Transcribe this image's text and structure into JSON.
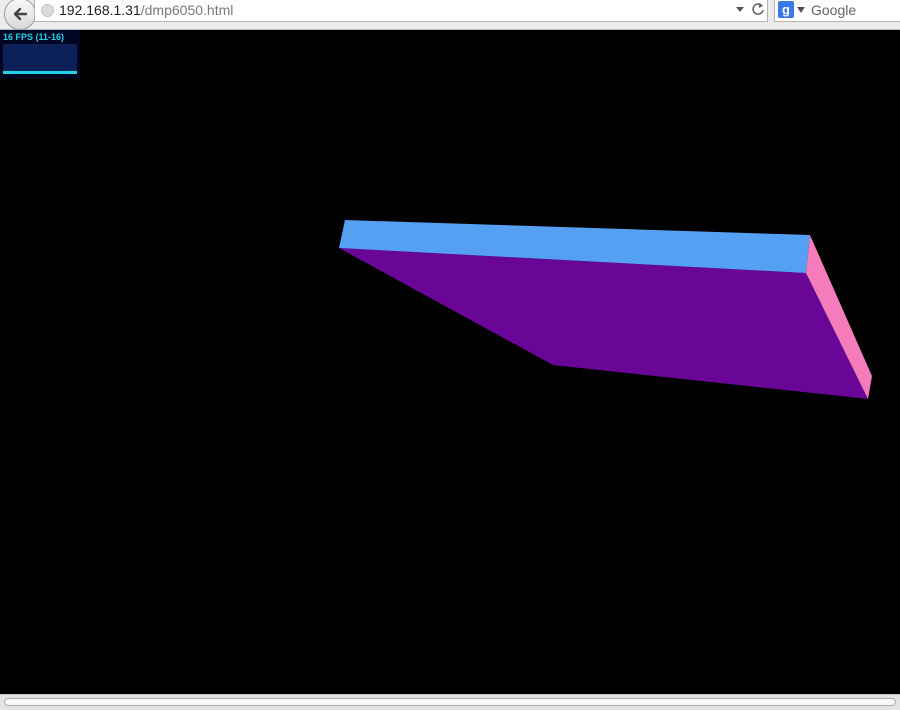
{
  "browser": {
    "url_host": "192.168.1.31",
    "url_path": "/dmp6050.html",
    "search_placeholder": "Google",
    "search_engine_icon": "google-icon",
    "icons": [
      "back-arrow-icon",
      "globe-icon",
      "dropdown-arrow-icon",
      "reload-icon"
    ]
  },
  "stats": {
    "label": "16 FPS (11-16)",
    "graph_level": 0.1
  },
  "scene": {
    "object": "box",
    "face_colors": {
      "front": "#55a0f2",
      "bottom": "#690597",
      "side": "#f57cba"
    }
  }
}
